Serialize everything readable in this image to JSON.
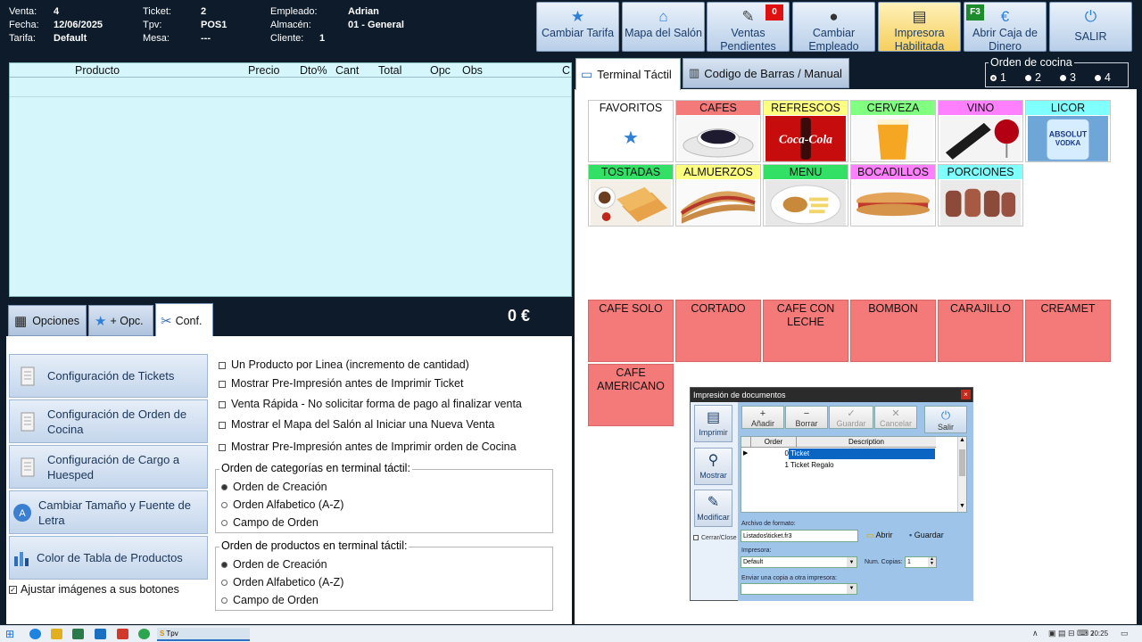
{
  "header": {
    "rows": [
      {
        "l1": "Venta:",
        "v1": "4",
        "l2": "Ticket:",
        "v2": "2",
        "l3": "Empleado:",
        "v3": "Adrian"
      },
      {
        "l1": "Fecha:",
        "v1": "12/06/2025",
        "l2": "Tpv:",
        "v2": "POS1",
        "l3": "Almacén:",
        "v3": "01 - General"
      },
      {
        "l1": "Tarifa:",
        "v1": "Default",
        "l2": "Mesa:",
        "v2": "---",
        "l3": "Cliente:",
        "v3": "1"
      }
    ]
  },
  "toolbar": {
    "cambiar_tarifa": "Cambiar Tarifa",
    "mapa_salon": "Mapa del Salón",
    "ventas_pendientes": "Ventas Pendientes",
    "ventas_badge": "0",
    "cambiar_empleado": "Cambiar Empleado",
    "impresora": "Impresora Habilitada",
    "abrir_caja": "Abrir Caja de Dinero",
    "abrir_badge": "F3",
    "salir": "SALIR"
  },
  "ticket_table": {
    "columns": [
      "Producto",
      "Precio",
      "Dto%",
      "Cant",
      "Total",
      "Opc",
      "Obs",
      "C"
    ],
    "total": "0 €"
  },
  "left_tabs": {
    "opciones": "Opciones",
    "mas_opc": "+ Opc.",
    "conf": "Conf."
  },
  "config": {
    "buttons": [
      "Configuración de Tickets",
      "Configuración de Orden de Cocina",
      "Configuración de Cargo a Huesped",
      "Cambiar Tamaño y Fuente de Letra",
      "Color de Tabla de Productos"
    ],
    "ajustar": "Ajustar imágenes a sus botones",
    "checks": [
      "Un Producto por Linea (incremento de cantidad)",
      "Mostrar Pre-Impresión antes de Imprimir Ticket",
      "Venta Rápida - No solicitar forma de pago al finalizar venta",
      "Mostrar el Mapa del Salón al Iniciar una Nueva Venta",
      "Mostrar Pre-Impresión antes de Imprimir orden de Cocina"
    ],
    "cat_group": {
      "title": "Orden de categorías en terminal táctil:",
      "options": [
        "Orden de Creación",
        "Orden Alfabetico (A-Z)",
        "Campo de Orden"
      ],
      "selected": 0
    },
    "prod_group": {
      "title": "Orden de productos en terminal táctil:",
      "options": [
        "Orden de Creación",
        "Orden Alfabetico (A-Z)",
        "Campo de Orden"
      ],
      "selected": 0
    }
  },
  "right_tabs": {
    "terminal": "Terminal Táctil",
    "codigo": "Codigo de Barras / Manual"
  },
  "orden_cocina": {
    "title": "Orden de cocina",
    "options": [
      "1",
      "2",
      "3",
      "4"
    ],
    "selected": 0
  },
  "categories": [
    {
      "label": "FAVORITOS",
      "color": "#ffffff"
    },
    {
      "label": "CAFES",
      "color": "#f47a7a"
    },
    {
      "label": "REFRESCOS",
      "color": "#ffff80"
    },
    {
      "label": "CERVEZA",
      "color": "#80ff80"
    },
    {
      "label": "VINO",
      "color": "#ff80ff"
    },
    {
      "label": "LICOR",
      "color": "#80ffff"
    },
    {
      "label": "TOSTADAS",
      "color": "#33e066"
    },
    {
      "label": "ALMUERZOS",
      "color": "#ffff80"
    },
    {
      "label": "MENU",
      "color": "#33e066"
    },
    {
      "label": "BOCADILLOS",
      "color": "#ff80ff"
    },
    {
      "label": "PORCIONES",
      "color": "#80ffff"
    }
  ],
  "image_text": {
    "cocacola": "Coca-Cola",
    "absolut": "ABSOLUT",
    "vodka": "VODKA"
  },
  "products": [
    "CAFE SOLO",
    "CORTADO",
    "CAFE CON LECHE",
    "BOMBON",
    "CARAJILLO",
    "CREAMET",
    "CAFE AMERICANO"
  ],
  "dialog": {
    "title": "Impresión de documentos",
    "side": [
      "Imprimir",
      "Mostrar",
      "Modificar"
    ],
    "cerrar": "Cerrar/Close",
    "toolbar": [
      "Añadir",
      "Borrar",
      "Guardar",
      "Cancelar"
    ],
    "salir": "Salir",
    "grid_cols": [
      "Order",
      "Description"
    ],
    "rows": [
      {
        "order": "0",
        "desc": "Ticket"
      },
      {
        "order": "1",
        "desc": "Ticket Regalo"
      }
    ],
    "archivo_label": "Archivo de formato:",
    "archivo_value": "Listados\\ticket.fr3",
    "abrir": "Abrir",
    "guardar": "Guardar",
    "impresora_label": "Impresora:",
    "impresora_value": "Default",
    "copias_label": "Num. Copias:",
    "copias_value": "1",
    "enviar_label": "Enviar una copia a otra impresora:"
  },
  "taskbar": {
    "app": "Tpv",
    "time": "20:25"
  }
}
